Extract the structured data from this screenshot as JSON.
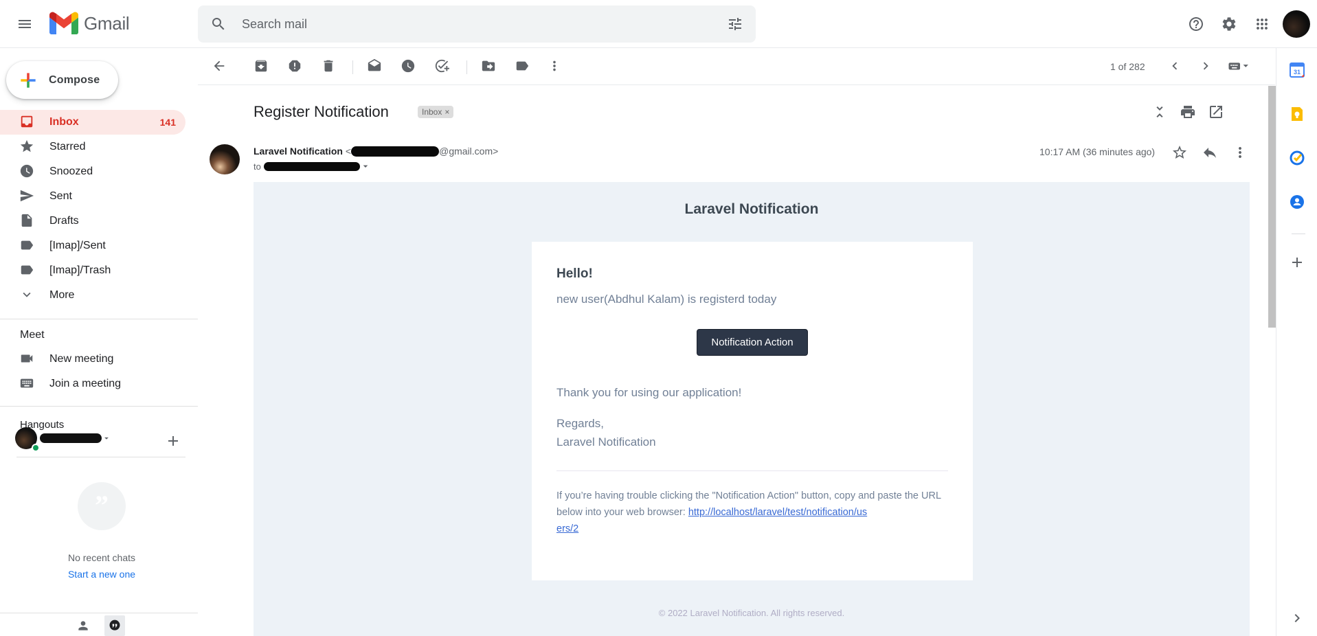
{
  "app": {
    "name": "Gmail"
  },
  "search": {
    "placeholder": "Search mail"
  },
  "compose": {
    "label": "Compose"
  },
  "nav": {
    "items": [
      {
        "label": "Inbox",
        "count": "141",
        "icon": "inbox-icon",
        "active": true
      },
      {
        "label": "Starred",
        "icon": "star-icon"
      },
      {
        "label": "Snoozed",
        "icon": "clock-icon"
      },
      {
        "label": "Sent",
        "icon": "send-icon"
      },
      {
        "label": "Drafts",
        "icon": "draft-icon"
      },
      {
        "label": "[Imap]/Sent",
        "icon": "label-icon"
      },
      {
        "label": "[Imap]/Trash",
        "icon": "label-icon"
      },
      {
        "label": "More",
        "icon": "chevron-down-icon"
      }
    ]
  },
  "meet": {
    "title": "Meet",
    "new_meeting": "New meeting",
    "join_meeting": "Join a meeting"
  },
  "hangouts": {
    "title": "Hangouts",
    "no_chats": "No recent chats",
    "start_new": "Start a new one"
  },
  "toolbar": {
    "page_count": "1 of 282"
  },
  "message": {
    "subject": "Register Notification",
    "label_chip": "Inbox",
    "sender_name": "Laravel Notification",
    "sender_email_suffix": "@gmail.com>",
    "to_prefix": "to",
    "time": "10:17 AM (36 minutes ago)"
  },
  "email": {
    "header": "Laravel Notification",
    "greeting": "Hello!",
    "line1": "new user(Abdhul Kalam) is registerd today",
    "action_label": "Notification Action",
    "thanks": "Thank you for using our application!",
    "regards": "Regards,",
    "signature": "Laravel Notification",
    "subcopy": "If you’re having trouble clicking the \"Notification Action\" button, copy and paste the URL below into your web browser:",
    "subcopy_url_line1": "http://localhost/laravel/test/notification/us",
    "subcopy_url_line2": "ers/2",
    "footer": "© 2022 Laravel Notification. All rights reserved."
  },
  "colors": {
    "accent_red": "#d93025",
    "active_bg": "#fce8e6",
    "button_dark": "#2d3748",
    "email_bg": "#edf2f7",
    "link": "#3869d4"
  }
}
